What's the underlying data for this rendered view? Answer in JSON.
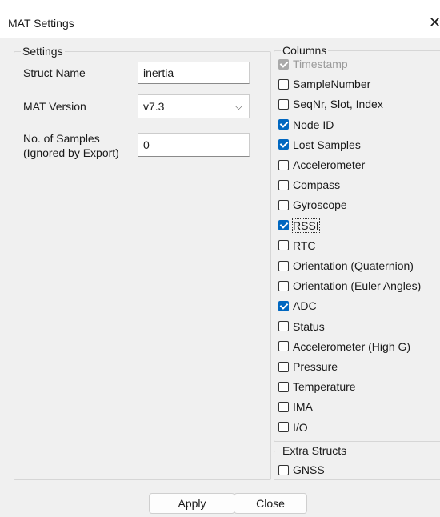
{
  "window": {
    "title": "MAT Settings"
  },
  "settings": {
    "legend": "Settings",
    "struct_name": {
      "label": "Struct Name",
      "value": "inertia"
    },
    "mat_version": {
      "label": "MAT Version",
      "value": "v7.3"
    },
    "samples": {
      "label_line1": "No. of Samples",
      "label_line2": "(Ignored by Export)",
      "value": "0"
    }
  },
  "columns": {
    "legend": "Columns",
    "items": [
      {
        "label": "Timestamp",
        "checked": true,
        "disabled": true
      },
      {
        "label": "SampleNumber",
        "checked": false
      },
      {
        "label": "SeqNr, Slot, Index",
        "checked": false
      },
      {
        "label": "Node ID",
        "checked": true
      },
      {
        "label": "Lost Samples",
        "checked": true
      },
      {
        "label": "Accelerometer",
        "checked": false
      },
      {
        "label": "Compass",
        "checked": false
      },
      {
        "label": "Gyroscope",
        "checked": false
      },
      {
        "label": "RSSI",
        "checked": true,
        "focused": true
      },
      {
        "label": "RTC",
        "checked": false
      },
      {
        "label": "Orientation (Quaternion)",
        "checked": false
      },
      {
        "label": "Orientation (Euler Angles)",
        "checked": false
      },
      {
        "label": "ADC",
        "checked": true
      },
      {
        "label": "Status",
        "checked": false
      },
      {
        "label": "Accelerometer (High G)",
        "checked": false
      },
      {
        "label": "Pressure",
        "checked": false
      },
      {
        "label": "Temperature",
        "checked": false
      },
      {
        "label": "IMA",
        "checked": false
      },
      {
        "label": "I/O",
        "checked": false
      }
    ]
  },
  "extra_structs": {
    "legend": "Extra Structs",
    "items": [
      {
        "label": "GNSS",
        "checked": false
      }
    ]
  },
  "buttons": {
    "apply": "Apply",
    "close": "Close"
  },
  "colors": {
    "accent": "#0067c0",
    "dialog_bg": "#f0f0f0"
  }
}
